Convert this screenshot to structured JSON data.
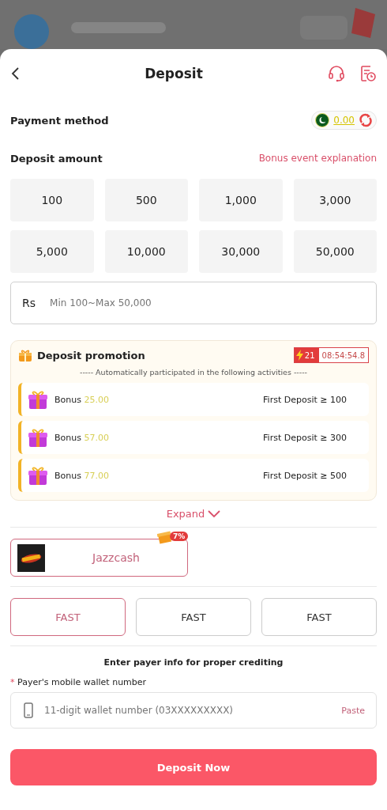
{
  "header": {
    "title": "Deposit"
  },
  "payment_method": {
    "label": "Payment method",
    "balance": "0.00"
  },
  "deposit_amount": {
    "label": "Deposit amount",
    "link": "Bonus event explanation",
    "amounts": [
      {
        "value": "100",
        "selected": false
      },
      {
        "value": "500",
        "selected": false
      },
      {
        "value": "1,000",
        "selected": false
      },
      {
        "value": "3,000",
        "selected": false
      },
      {
        "value": "5,000",
        "selected": false
      },
      {
        "value": "10,000",
        "selected": false
      },
      {
        "value": "30,000",
        "selected": false
      },
      {
        "value": "50,000",
        "selected": false
      }
    ],
    "input": {
      "prefix": "Rs",
      "placeholder": "Min 100~Max 50,000"
    }
  },
  "promotion": {
    "title": "Deposit promotion",
    "timer_count": "21",
    "timer": "08:54:54.8",
    "subtitle": "----- Automatically participated in the following activities -----",
    "items": [
      {
        "label": "Bonus",
        "amount": "25.00",
        "condition": "First Deposit ≥ 100"
      },
      {
        "label": "Bonus",
        "amount": "57.00",
        "condition": "First Deposit ≥ 300"
      },
      {
        "label": "Bonus",
        "amount": "77.00",
        "condition": "First Deposit ≥ 500"
      }
    ],
    "expand": "Expand"
  },
  "channels": [
    {
      "name": "Jazzcash",
      "badge": "7%",
      "selected": true
    }
  ],
  "speeds": [
    {
      "label": "FAST",
      "selected": true
    },
    {
      "label": "FAST",
      "selected": false
    },
    {
      "label": "FAST",
      "selected": false
    }
  ],
  "payer": {
    "heading": "Enter payer info for proper crediting",
    "required_mark": "*",
    "label": "Payer's mobile wallet number",
    "placeholder": "11-digit wallet number (03XXXXXXXXX)",
    "paste": "Paste"
  },
  "submit": "Deposit Now"
}
